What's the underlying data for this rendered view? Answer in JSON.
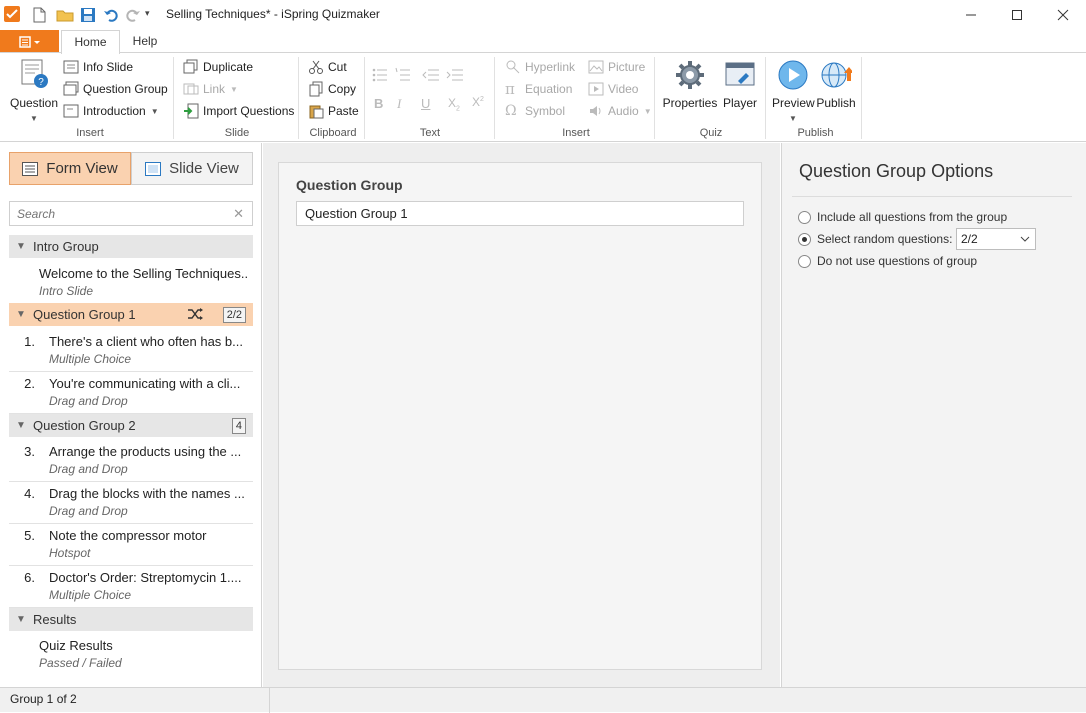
{
  "app": {
    "title": "Selling Techniques* - iSpring Quizmaker"
  },
  "tabs": [
    {
      "label": "Home",
      "active": true
    },
    {
      "label": "Help",
      "active": false
    }
  ],
  "ribbon": {
    "insert": {
      "question": "Question",
      "info_slide": "Info Slide",
      "question_group": "Question Group",
      "introduction": "Introduction",
      "group_label": "Insert"
    },
    "slide": {
      "duplicate": "Duplicate",
      "link": "Link",
      "import_questions": "Import Questions",
      "group_label": "Slide"
    },
    "clipboard": {
      "cut": "Cut",
      "copy": "Copy",
      "paste": "Paste",
      "group_label": "Clipboard"
    },
    "text": {
      "group_label": "Text"
    },
    "insert2": {
      "hyperlink": "Hyperlink",
      "equation": "Equation",
      "symbol": "Symbol",
      "picture": "Picture",
      "video": "Video",
      "audio": "Audio",
      "group_label": "Insert"
    },
    "quiz": {
      "properties": "Properties",
      "player": "Player",
      "group_label": "Quiz"
    },
    "publish": {
      "preview": "Preview",
      "publish": "Publish",
      "group_label": "Publish"
    }
  },
  "left_panel": {
    "form_view": "Form View",
    "slide_view": "Slide View",
    "search_placeholder": "Search",
    "groups": [
      {
        "name": "Intro Group",
        "slides": [
          {
            "title": "Welcome to the Selling Techniques...",
            "type": "Intro Slide"
          }
        ]
      },
      {
        "name": "Question Group 1",
        "count": "2/2",
        "selected": true,
        "slides": [
          {
            "num": "1.",
            "title": "There's a client who often has b...",
            "type": "Multiple Choice"
          },
          {
            "num": "2.",
            "title": "You're communicating with a cli...",
            "type": "Drag and Drop"
          }
        ]
      },
      {
        "name": "Question Group 2",
        "count": "4",
        "slides": [
          {
            "num": "3.",
            "title": "Arrange the products using the ...",
            "type": "Drag and Drop"
          },
          {
            "num": "4.",
            "title": "Drag the blocks with the names ...",
            "type": "Drag and Drop"
          },
          {
            "num": "5.",
            "title": "Note the compressor motor",
            "type": "Hotspot"
          },
          {
            "num": "6.",
            "title": "Doctor's Order: Streptomycin 1....",
            "type": "Multiple Choice"
          }
        ]
      },
      {
        "name": "Results",
        "slides": [
          {
            "title": "Quiz Results",
            "type": "Passed / Failed"
          }
        ]
      }
    ]
  },
  "center": {
    "label": "Question Group",
    "value": "Question Group 1"
  },
  "right_panel": {
    "title": "Question Group Options",
    "options": [
      {
        "label": "Include all questions from the group",
        "selected": false
      },
      {
        "label": "Select random questions:",
        "selected": true
      },
      {
        "label": "Do not use questions of group",
        "selected": false
      }
    ],
    "random_value": "2/2"
  },
  "status": {
    "text": "Group 1 of 2"
  },
  "colors": {
    "accent": "#f07a1c",
    "selected": "#fad2b0",
    "brand_blue": "#2b79c2"
  },
  "icons": {
    "undo": "undo-icon",
    "redo": "redo-icon",
    "save": "save-icon",
    "shuffle": "shuffle-icon"
  }
}
